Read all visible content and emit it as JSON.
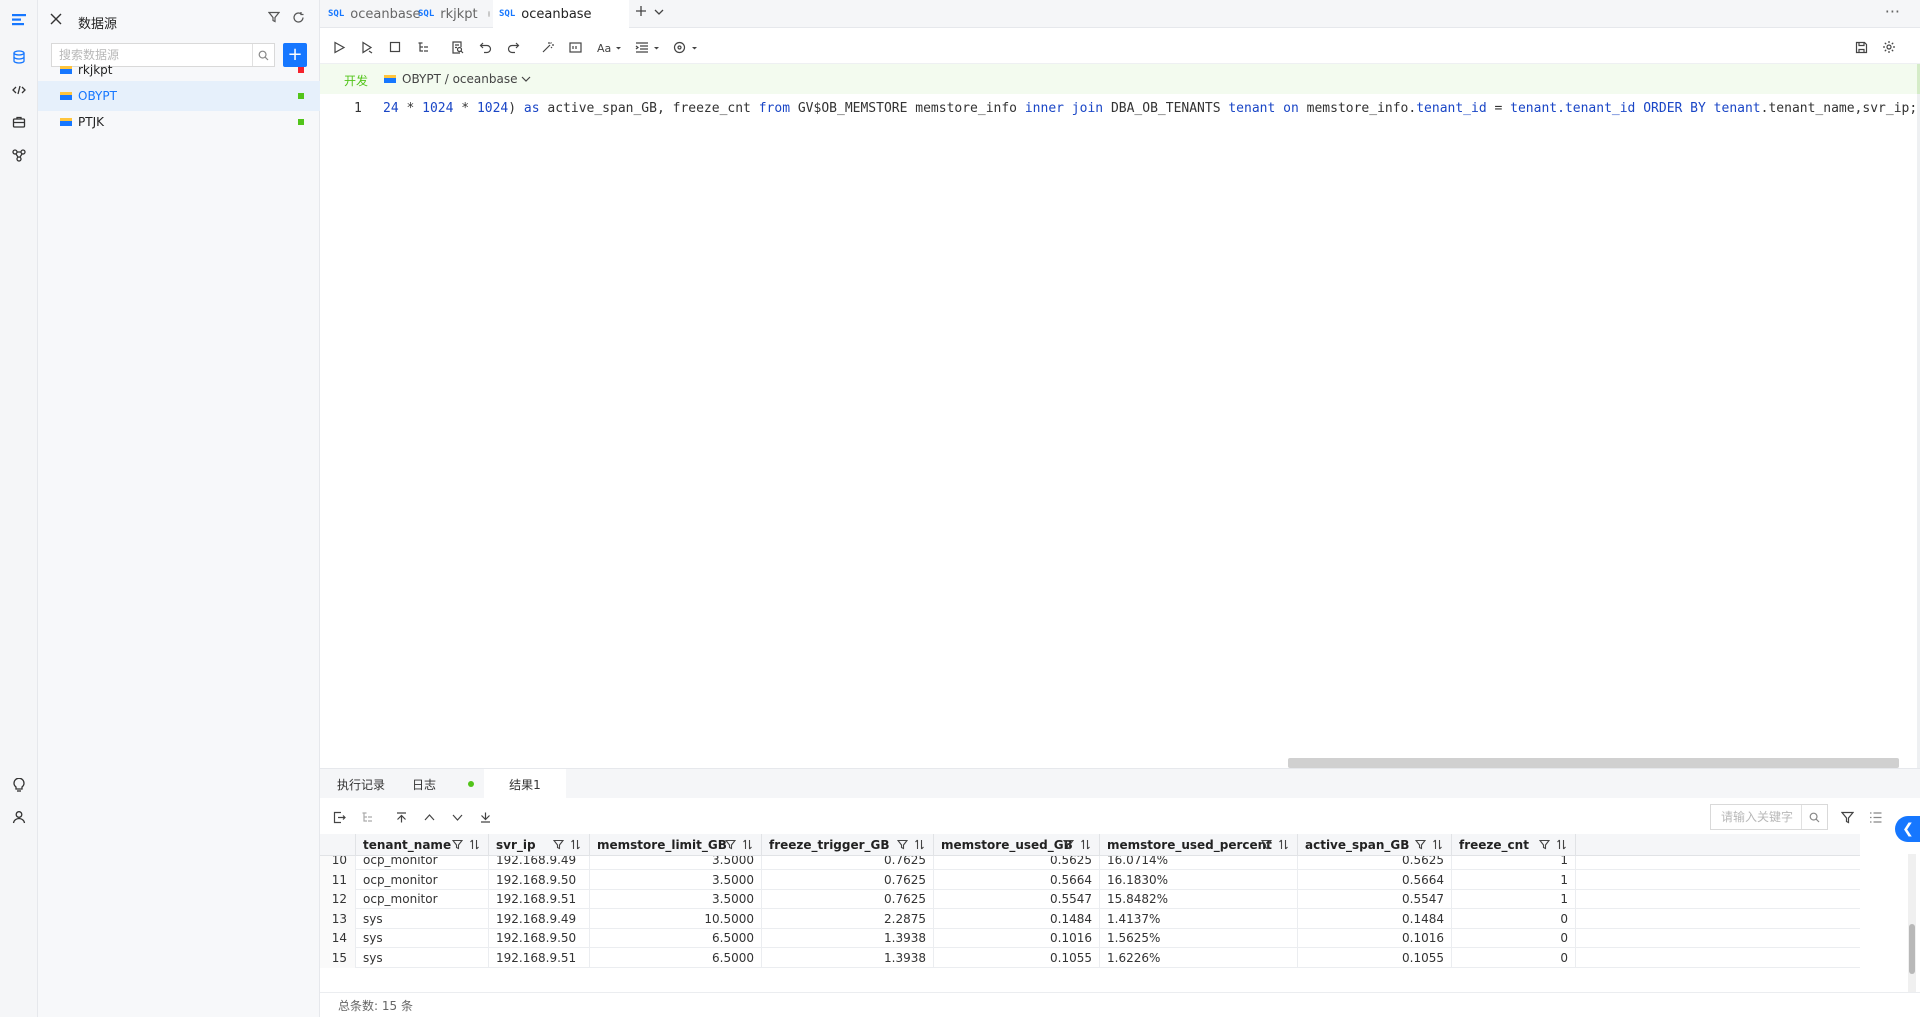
{
  "sidebar": {
    "title": "数据源",
    "search_placeholder": "搜索数据源",
    "items": [
      {
        "label": "rkjkpt",
        "status_color": "#f5222d",
        "selected": false
      },
      {
        "label": "OBYPT",
        "status_color": "#52c41a",
        "selected": true
      },
      {
        "label": "PTJK",
        "status_color": "#52c41a",
        "selected": false
      }
    ]
  },
  "tabs": [
    {
      "tag": "SQL",
      "label": "oceanbase",
      "active": false
    },
    {
      "tag": "SQL",
      "label": "rkjkpt",
      "active": false
    },
    {
      "tag": "SQL",
      "label": "oceanbase",
      "active": true
    }
  ],
  "env": {
    "tag": "开发",
    "db_path": "OBYPT / oceanbase"
  },
  "editor": {
    "line_number": "1"
  },
  "result_tabs": [
    {
      "label": "执行记录",
      "active": false
    },
    {
      "label": "日志",
      "active": false
    },
    {
      "label": "结果1",
      "active": true
    }
  ],
  "result": {
    "search_placeholder": "请输入关键字",
    "columns": [
      "tenant_name",
      "svr_ip",
      "memstore_limit_GB",
      "freeze_trigger_GB",
      "memstore_used_GB",
      "memstore_used_percent",
      "active_span_GB",
      "freeze_cnt"
    ],
    "rows": [
      {
        "idx": "10",
        "cells": [
          "ocp_monitor",
          "192.168.9.49",
          "3.5000",
          "0.7625",
          "0.5625",
          "16.0714%",
          "0.5625",
          "1"
        ]
      },
      {
        "idx": "11",
        "cells": [
          "ocp_monitor",
          "192.168.9.50",
          "3.5000",
          "0.7625",
          "0.5664",
          "16.1830%",
          "0.5664",
          "1"
        ]
      },
      {
        "idx": "12",
        "cells": [
          "ocp_monitor",
          "192.168.9.51",
          "3.5000",
          "0.7625",
          "0.5547",
          "15.8482%",
          "0.5547",
          "1"
        ]
      },
      {
        "idx": "13",
        "cells": [
          "sys",
          "192.168.9.49",
          "10.5000",
          "2.2875",
          "0.1484",
          "1.4137%",
          "0.1484",
          "0"
        ]
      },
      {
        "idx": "14",
        "cells": [
          "sys",
          "192.168.9.50",
          "6.5000",
          "1.3938",
          "0.1016",
          "1.5625%",
          "0.1016",
          "0"
        ]
      },
      {
        "idx": "15",
        "cells": [
          "sys",
          "192.168.9.51",
          "6.5000",
          "1.3938",
          "0.1055",
          "1.6226%",
          "0.1055",
          "0"
        ]
      }
    ],
    "total_label": "总条数: 15 条"
  },
  "colors": {
    "accent": "#1677ff",
    "keyword": "#1a46c6",
    "env_green": "#52c41a"
  }
}
